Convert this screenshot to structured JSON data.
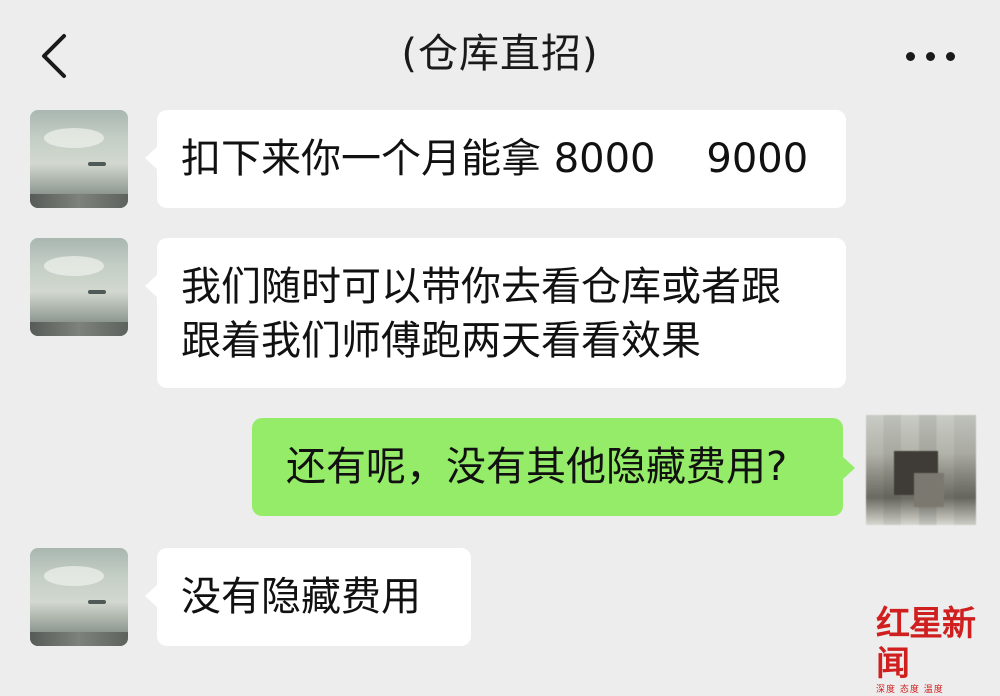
{
  "header": {
    "title": "(仓库直招)"
  },
  "messages": [
    {
      "direction": "in",
      "text": "扣下来你一个月能拿 8000    9000"
    },
    {
      "direction": "in",
      "line1": "我们随时可以带你去看仓库或者跟",
      "line2": "跟着我们师傅跑两天看看效果"
    },
    {
      "direction": "out",
      "text": "还有呢，没有其他隐藏费用?"
    },
    {
      "direction": "in",
      "text": "没有隐藏费用"
    }
  ],
  "watermark": {
    "name": "红星新闻",
    "tagline": "深度 态度 温度"
  },
  "colors": {
    "background": "#ededed",
    "incoming_bubble": "#ffffff",
    "outgoing_bubble": "#95ec69",
    "watermark": "#cf1f1f"
  }
}
